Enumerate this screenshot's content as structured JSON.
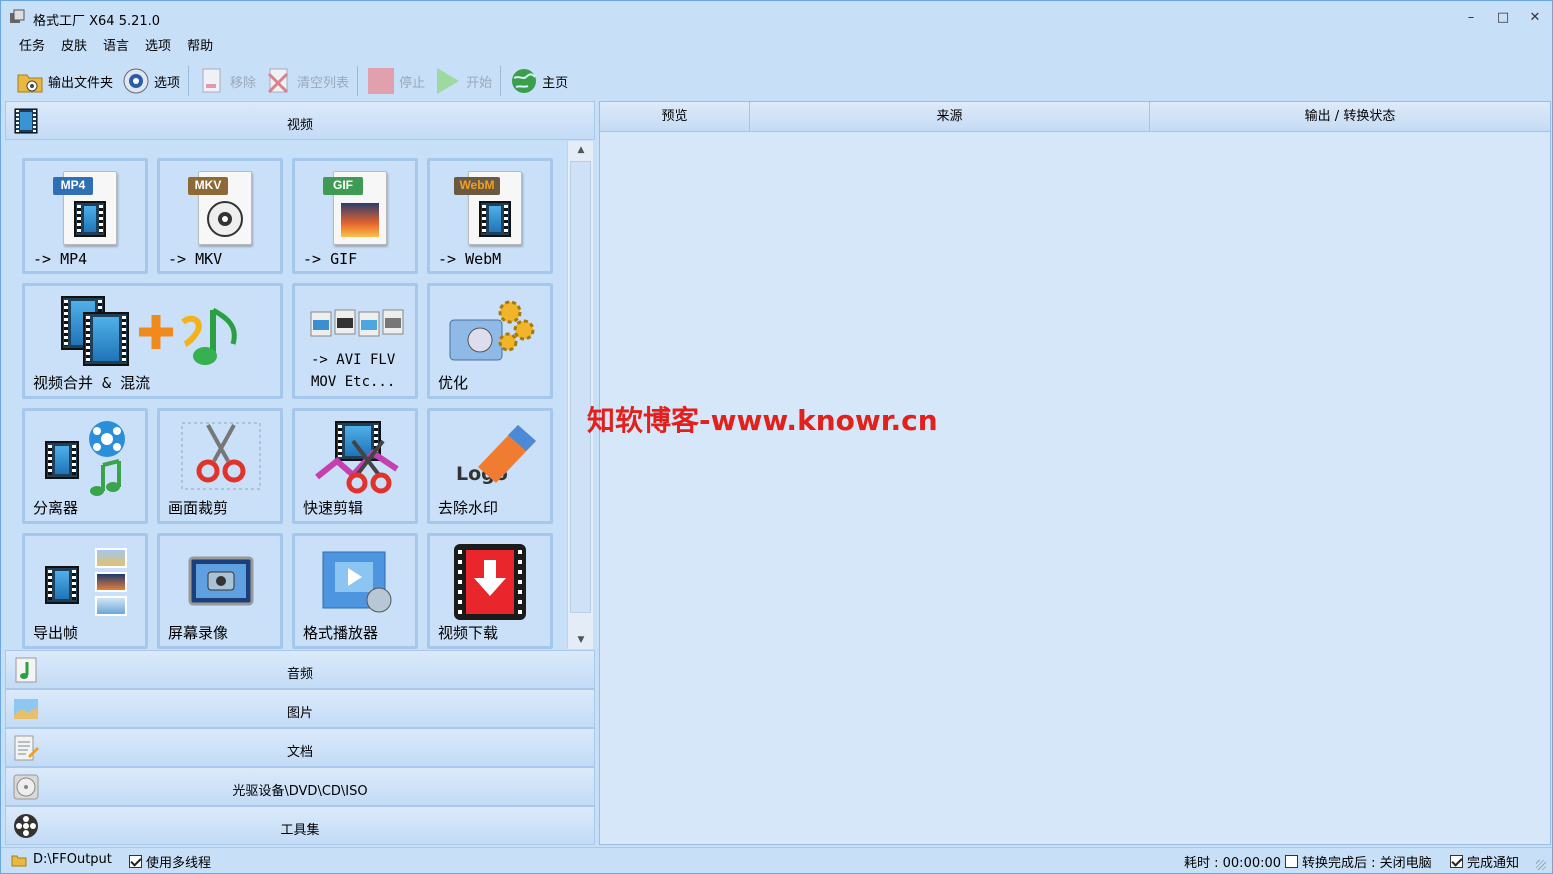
{
  "window": {
    "title": "格式工厂 X64 5.21.0",
    "min": "–",
    "max": "□",
    "close": "✕"
  },
  "menu": [
    "任务",
    "皮肤",
    "语言",
    "选项",
    "帮助"
  ],
  "toolbar": {
    "output_folder": "输出文件夹",
    "options": "选项",
    "remove": "移除",
    "clear_list": "清空列表",
    "stop": "停止",
    "start": "开始",
    "home": "主页"
  },
  "categories": {
    "video": "视频",
    "audio": "音频",
    "picture": "图片",
    "document": "文档",
    "rom": "光驱设备\\DVD\\CD\\ISO",
    "tools": "工具集"
  },
  "tiles": {
    "mp4": {
      "badge": "MP4",
      "label": "-> MP4"
    },
    "mkv": {
      "badge": "MKV",
      "label": "-> MKV"
    },
    "gif": {
      "badge": "GIF",
      "label": "-> GIF"
    },
    "webm": {
      "badge": "WebM",
      "label": "-> WebM"
    },
    "merge": {
      "label": "视频合并 & 混流"
    },
    "other": {
      "line1": "-> AVI FLV",
      "line2": "MOV Etc..."
    },
    "optimize": {
      "label": "优化"
    },
    "splitter": {
      "label": "分离器"
    },
    "crop": {
      "label": "画面裁剪"
    },
    "quick_clip": {
      "label": "快速剪辑"
    },
    "delogo": {
      "label": "去除水印",
      "logo_text": "Logo"
    },
    "export_frames": {
      "label": "导出帧"
    },
    "screen_record": {
      "label": "屏幕录像"
    },
    "player": {
      "label": "格式播放器"
    },
    "download": {
      "label": "视频下载"
    }
  },
  "table": {
    "columns": [
      "预览",
      "来源",
      "输出 / 转换状态"
    ]
  },
  "watermark": "知软博客-www.knowr.cn",
  "status": {
    "output_path": "D:\\FFOutput",
    "multithread_label": "使用多线程",
    "multithread_checked": true,
    "elapsed": "耗时 : 00:00:00",
    "after_convert_label": "转换完成后 : 关闭电脑",
    "after_convert_checked": false,
    "notify_label": "完成通知",
    "notify_checked": true
  },
  "colors": {
    "accent": "#c8dff8",
    "watermark": "#e2201c"
  }
}
